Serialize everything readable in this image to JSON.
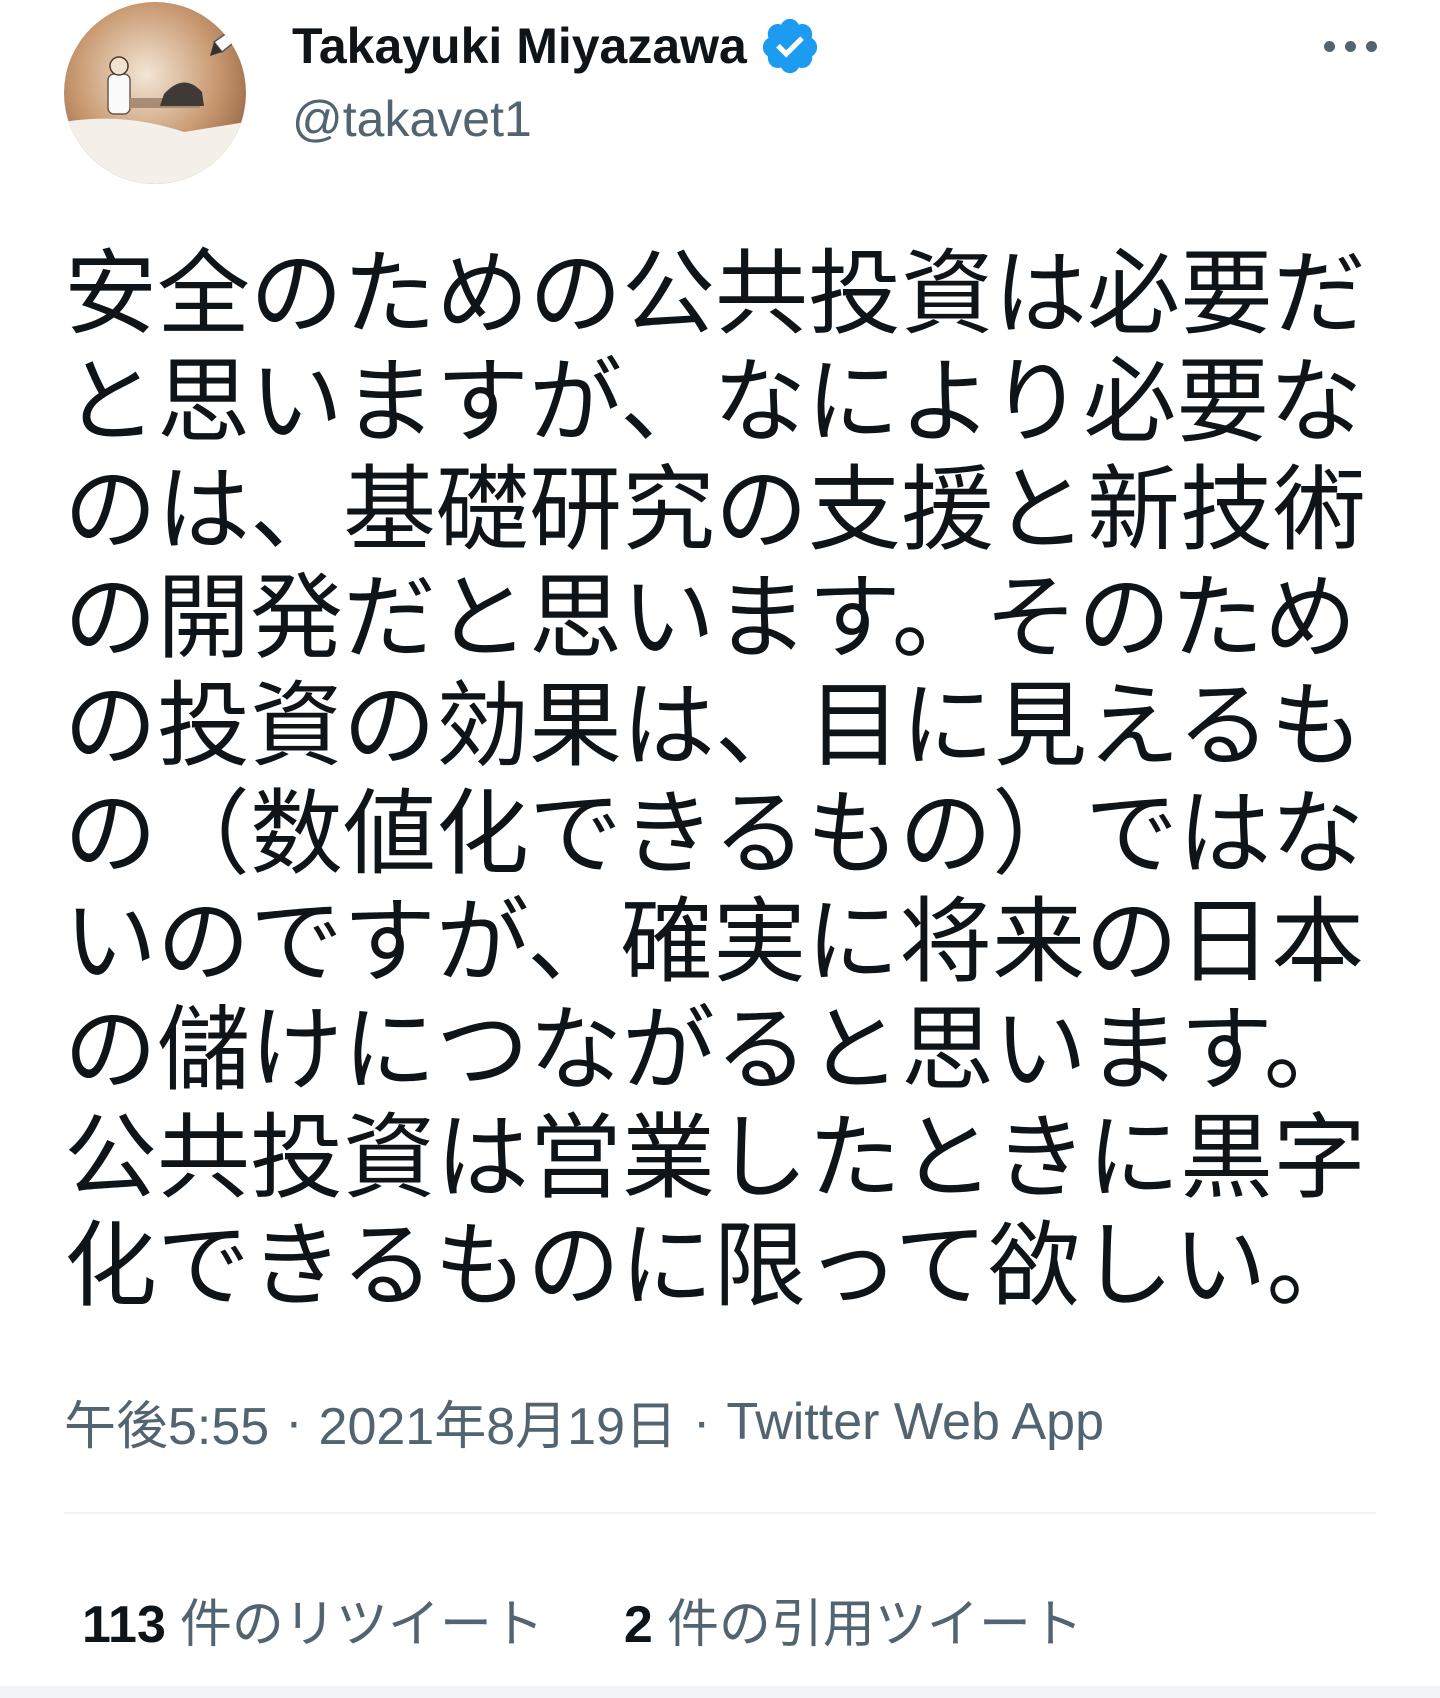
{
  "tweet": {
    "author": {
      "display_name": "Takayuki Miyazawa",
      "handle": "@takavet1",
      "verified": true,
      "verified_icon": "verified-badge-icon",
      "avatar_icon": "avatar-illustration-icon"
    },
    "more_icon": "more-options-icon",
    "text_lines": [
      "安全のための公共投資は必要だ",
      "と思いますが、なにより必要な",
      "のは、基礎研究の支援と新技術",
      "の開発だと思います。そのため",
      "の投資の効果は、目に見えるも",
      "の（数値化できるもの）ではな",
      "いのですが、確実に将来の日本",
      "の儲けにつながると思います。",
      "公共投資は営業したときに黒字",
      "化できるものに限って欲しい。"
    ],
    "timestamp": "午後5:55",
    "date": "2021年8月19日",
    "separator": "·",
    "source": "Twitter Web App",
    "stats": {
      "retweets": {
        "count": "113",
        "label": "件のリツイート"
      },
      "quotes": {
        "count": "2",
        "label": "件の引用ツイート"
      }
    }
  },
  "colors": {
    "text_primary": "#0f1419",
    "text_secondary": "#536471",
    "verified_blue": "#1d9bf0",
    "divider": "#eff3f4"
  }
}
